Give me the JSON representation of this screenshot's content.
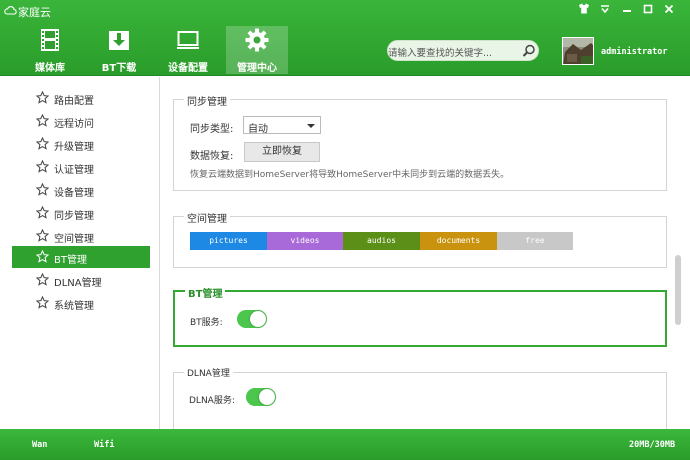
{
  "app": {
    "title": "家庭云"
  },
  "window_controls": [
    "shirt-icon",
    "menu-icon",
    "minimize-icon",
    "maximize-icon",
    "close-icon"
  ],
  "nav": {
    "tabs": [
      {
        "label": "媒体库",
        "icon": "film-icon"
      },
      {
        "label": "BT下载",
        "icon": "download-icon"
      },
      {
        "label": "设备配置",
        "icon": "monitor-icon"
      },
      {
        "label": "管理中心",
        "icon": "gear-icon",
        "active": true
      }
    ]
  },
  "search": {
    "placeholder": "请输入要查找的关键字..."
  },
  "user": {
    "name": "administrator"
  },
  "sidebar": {
    "items": [
      {
        "label": "路由配置"
      },
      {
        "label": "远程访问"
      },
      {
        "label": "升级管理"
      },
      {
        "label": "认证管理"
      },
      {
        "label": "设备管理"
      },
      {
        "label": "同步管理"
      },
      {
        "label": "空间管理"
      },
      {
        "label": "BT管理",
        "active": true
      },
      {
        "label": "DLNA管理"
      },
      {
        "label": "系统管理"
      }
    ]
  },
  "sync": {
    "legend": "同步管理",
    "type_label": "同步类型:",
    "type_value": "自动",
    "restore_label": "数据恢复:",
    "restore_button": "立即恢复",
    "hint": "恢复云端数据到HomeServer将导致HomeServer中未同步到云端的数据丢失。"
  },
  "space": {
    "legend": "空间管理",
    "segments": [
      {
        "label": "pictures",
        "color": "#1e88e5"
      },
      {
        "label": "videos",
        "color": "#a86ad8"
      },
      {
        "label": "audios",
        "color": "#5c8f18"
      },
      {
        "label": "documents",
        "color": "#c9930f"
      },
      {
        "label": "free",
        "color": "#c8c8c8"
      }
    ]
  },
  "bt": {
    "legend": "BT管理",
    "service_label": "BT服务:",
    "enabled": true
  },
  "dlna": {
    "legend": "DLNA管理",
    "service_label": "DLNA服务:",
    "enabled": true
  },
  "status": {
    "wan": "Wan",
    "wifi": "Wifi",
    "storage": "20MB/30MB"
  },
  "colors": {
    "brand_green": "#2ea12e",
    "toggle_on": "#4cc64c"
  }
}
